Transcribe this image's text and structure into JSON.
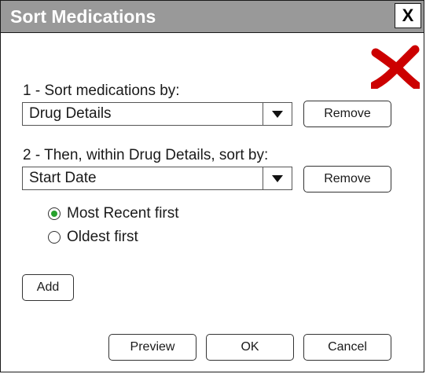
{
  "dialog": {
    "title": "Sort Medications",
    "close_label": "X",
    "close_icon": "close-icon",
    "error_icon": "red-x-icon",
    "accent_color": "#cc0000"
  },
  "sort1": {
    "label": "1 - Sort medications by:",
    "value": "Drug Details",
    "remove_label": "Remove"
  },
  "sort2": {
    "label": "2 - Then, within Drug Details, sort by:",
    "value": "Start Date",
    "remove_label": "Remove"
  },
  "order": {
    "options": [
      {
        "label": "Most Recent first",
        "selected": true
      },
      {
        "label": "Oldest first",
        "selected": false
      }
    ],
    "selected_color": "#27a12d"
  },
  "actions": {
    "add_label": "Add",
    "preview_label": "Preview",
    "ok_label": "OK",
    "cancel_label": "Cancel"
  }
}
